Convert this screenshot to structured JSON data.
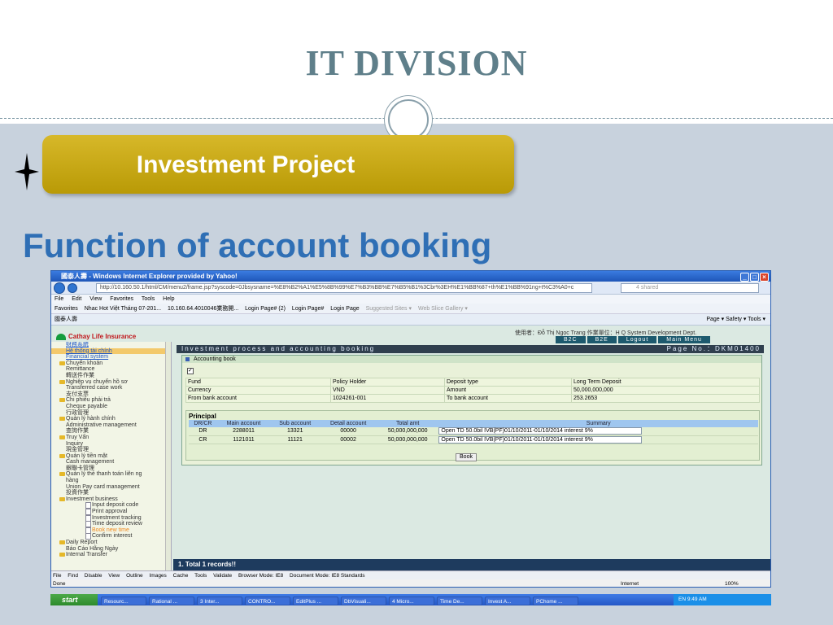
{
  "slide": {
    "title": "IT DIVISION",
    "subtitle": "Investment Project",
    "heading": "Function of account booking"
  },
  "browser": {
    "window_title": "國泰人壽 - Windows Internet Explorer provided by Yahoo!",
    "address": "http://10.160.50.1/html/CM/menu2/frame.jsp?syscode=0Jbsysname=%E8%B2%A1%E5%8B%99%E7%B3%BB%E7%B5%B1%3Cbr%3EH%E1%BB%87+th%E1%BB%91ng+t%C3%A0+c",
    "search_placeholder": "4 shared",
    "menu": [
      "File",
      "Edit",
      "View",
      "Favorites",
      "Tools",
      "Help"
    ],
    "favorites_label": "Favorites",
    "favorites": [
      "Nhac Hot Việt Tháng 07-201...",
      "10.160.64.4010046業務開...",
      "Login Page# (2)",
      "Login Page#",
      "Login Page",
      "Suggested Sites ▾",
      "Web Slice Gallery ▾"
    ],
    "tab": "國泰人壽",
    "command_bar": "Page ▾  Safety ▾  Tools ▾",
    "status_menu": [
      "File",
      "Find",
      "Disable",
      "View",
      "Outline",
      "Images",
      "Cache",
      "Tools",
      "Validate",
      "Browser Mode: IE8",
      "Document Mode: IE8 Standards"
    ],
    "status_left": "Done",
    "status_zone": "Internet",
    "status_zoom": "100%"
  },
  "app": {
    "logo": "Cathay Life Insurance",
    "user_line": "使用者：Đỗ Thị Ngọc Trang   作業單位：H Q System Development Dept.",
    "nav": [
      "B2C",
      "B2E",
      "Logout",
      "Main Menu"
    ],
    "tree": [
      {
        "text": "財務系統",
        "cls": "link"
      },
      {
        "text": "Hệ thống tài chính",
        "cls": "link hl"
      },
      {
        "text": "Financial system",
        "cls": "link"
      },
      {
        "text": "Chuyển khoản",
        "cls": "folder"
      },
      {
        "text": "Remittance",
        "cls": ""
      },
      {
        "text": "轉送件作業",
        "cls": ""
      },
      {
        "text": "Nghiệp vụ chuyển hồ sơ",
        "cls": "folder"
      },
      {
        "text": "Transferred case work",
        "cls": ""
      },
      {
        "text": "支付支票",
        "cls": ""
      },
      {
        "text": "Chi phiếu phải trả",
        "cls": "folder"
      },
      {
        "text": "Cheque payable",
        "cls": ""
      },
      {
        "text": "行政管理",
        "cls": ""
      },
      {
        "text": "Quản lý hành chính",
        "cls": "folder"
      },
      {
        "text": "Administrative management",
        "cls": ""
      },
      {
        "text": "查詢作業",
        "cls": ""
      },
      {
        "text": "Truy Vấn",
        "cls": "folder"
      },
      {
        "text": "Inquiry",
        "cls": ""
      },
      {
        "text": "現金管理",
        "cls": ""
      },
      {
        "text": "Quản lý tiền mặt",
        "cls": "folder"
      },
      {
        "text": "Cash management",
        "cls": ""
      },
      {
        "text": "銀聯卡管理",
        "cls": ""
      },
      {
        "text": "Quản lý thẻ thanh toán liên ng",
        "cls": "folder"
      },
      {
        "text": "hàng",
        "cls": ""
      },
      {
        "text": "Union Pay card management",
        "cls": ""
      },
      {
        "text": "投資作業",
        "cls": ""
      },
      {
        "text": "Investment business",
        "cls": "folder"
      },
      {
        "text": "Input deposit code",
        "cls": "leaf"
      },
      {
        "text": "Print approval",
        "cls": "leaf"
      },
      {
        "text": "Investment tracking",
        "cls": "leaf"
      },
      {
        "text": "Time deposit review",
        "cls": "leaf"
      },
      {
        "text": "Book new time",
        "cls": "leaf orange"
      },
      {
        "text": "Confirm interest",
        "cls": "leaf"
      },
      {
        "text": "Daily Report",
        "cls": "folder"
      },
      {
        "text": "Báo Cáo Hằng Ngày",
        "cls": ""
      },
      {
        "text": "Internal Transfer",
        "cls": "folder"
      }
    ],
    "header": "Investment process and accounting booking",
    "page_no": "Page No.：DKM01400",
    "panel_title": "Accounting book",
    "checkbox": "✓",
    "info": [
      [
        "Fund",
        "",
        "Policy Holder",
        "",
        "Deposit type",
        "Long Term Deposit"
      ],
      [
        "Currency",
        "",
        "VND",
        "",
        "Amount",
        "50,000,000,000"
      ],
      [
        "From bank account",
        "",
        "1024261-001",
        "",
        "To bank account",
        "253.2653"
      ]
    ],
    "principal_label": "Principal",
    "principal_headers": [
      "DR/CR",
      "Main account",
      "Sub account",
      "Detail account",
      "Total amt",
      "Summary"
    ],
    "principal_rows": [
      [
        "DR",
        "2288011",
        "13321",
        "00000",
        "50,000,000,000",
        "Open TD 50.0bil IVB(PF)01/10/2011-01/10/2014 interest 9%"
      ],
      [
        "CR",
        "1121011",
        "11121",
        "00002",
        "50,000,000,000",
        "Open TD 50.0bil IVB(PF)01/10/2011-01/10/2014 interest 9%"
      ]
    ],
    "book_button": "Book",
    "records": "1. Total 1 records!!"
  },
  "taskbar": {
    "start": "start",
    "tasks": [
      "Resourc...",
      "Rational ...",
      "3 Inter...",
      "CONTRO...",
      "EditPlus ...",
      "DbVisuali...",
      "4 Micro...",
      "Time De...",
      "Invest A...",
      "PChome ..."
    ],
    "tray": "EN      9:49 AM"
  }
}
